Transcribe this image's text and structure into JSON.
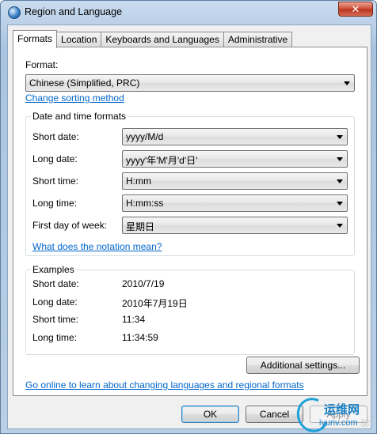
{
  "window": {
    "title": "Region and Language",
    "close_glyph": "✕"
  },
  "tabs": [
    {
      "label": "Formats",
      "active": true
    },
    {
      "label": "Location",
      "active": false
    },
    {
      "label": "Keyboards and Languages",
      "active": false
    },
    {
      "label": "Administrative",
      "active": false
    }
  ],
  "formats": {
    "format_label": "Format:",
    "format_value": "Chinese (Simplified, PRC)",
    "change_sorting_link": "Change sorting method",
    "date_time_group_title": "Date and time formats",
    "rows": [
      {
        "label": "Short date:",
        "value": "yyyy/M/d"
      },
      {
        "label": "Long date:",
        "value": "yyyy'年'M'月'd'日'"
      },
      {
        "label": "Short time:",
        "value": "H:mm"
      },
      {
        "label": "Long time:",
        "value": "H:mm:ss"
      },
      {
        "label": "First day of week:",
        "value": "星期日"
      }
    ],
    "notation_link": "What does the notation mean?",
    "examples_group_title": "Examples",
    "examples": [
      {
        "label": "Short date:",
        "value": "2010/7/19"
      },
      {
        "label": "Long date:",
        "value": "2010年7月19日"
      },
      {
        "label": "Short time:",
        "value": "11:34"
      },
      {
        "label": "Long time:",
        "value": "11:34:59"
      }
    ],
    "additional_settings_button": "Additional settings...",
    "online_link": "Go online to learn about changing languages and regional formats"
  },
  "footer": {
    "ok_button": "OK",
    "cancel_button": "Cancel",
    "apply_button": "Apply"
  },
  "watermark": {
    "text_line1": "运维网",
    "text_line2": "iyunv.com"
  },
  "colors": {
    "link": "#0066cc",
    "title_bar": "#bcd1e8",
    "close_button": "#cf4b33"
  }
}
